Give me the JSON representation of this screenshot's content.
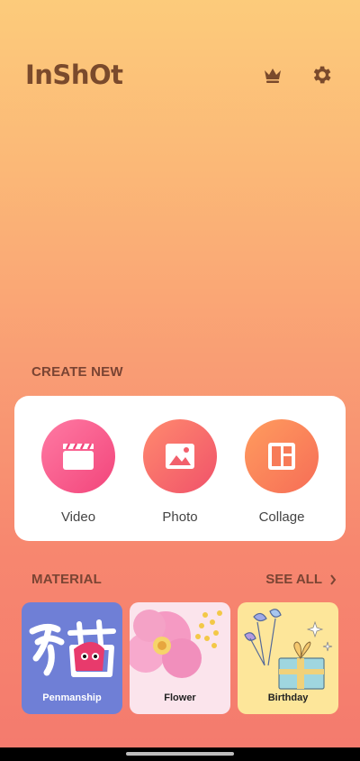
{
  "header": {
    "logo": "InShOt",
    "crown_icon": "crown-icon",
    "settings_icon": "gear-icon"
  },
  "create": {
    "title": "CREATE NEW",
    "items": [
      {
        "label": "Video",
        "icon": "clapperboard-icon",
        "color": "#f2457b"
      },
      {
        "label": "Photo",
        "icon": "image-icon",
        "color": "#f0526a"
      },
      {
        "label": "Collage",
        "icon": "collage-layout-icon",
        "color": "#f66d57"
      }
    ]
  },
  "material": {
    "title": "MATERIAL",
    "see_all": "SEE ALL",
    "cards": [
      {
        "label": "Penmanship",
        "bg": "#6f7fd6"
      },
      {
        "label": "Flower",
        "bg": "#fbe4ec"
      },
      {
        "label": "Birthday",
        "bg": "#fde69a"
      }
    ]
  },
  "colors": {
    "brand_text": "#7a4a2c",
    "section_text": "#7a4433"
  }
}
